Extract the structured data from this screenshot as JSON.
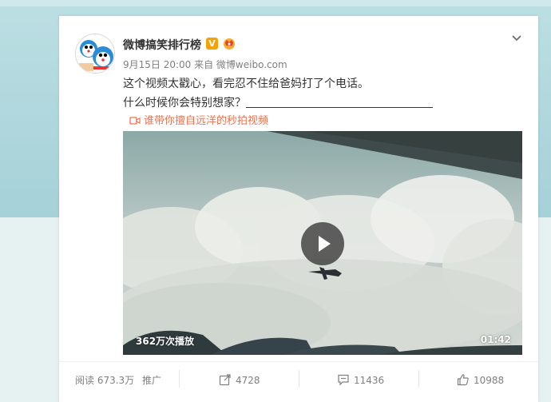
{
  "post": {
    "author": "微博搞笑排行榜",
    "verified_badge": "V",
    "meta": "9月15日 20:00 来自 微博weibo.com",
    "text_line1": "这个视频太戳心，看完忍不住给爸妈打了个电话。",
    "text_line2": "什么时候你会特别想家？",
    "video_link_label": "谁带你擅自远洋的秒拍视频"
  },
  "video": {
    "play_count": "362万次播放",
    "duration": "01:42"
  },
  "footer": {
    "read_count": "阅读 673.3万",
    "promote": "推广",
    "repost_count": "4728",
    "comment_count": "11436",
    "like_count": "10988"
  },
  "colors": {
    "accent_link": "#eb7350",
    "badge_orange": "#f7a200",
    "text_main": "#333333",
    "text_meta": "#808080"
  },
  "icons": [
    "chevron-down-icon",
    "video-camera-icon",
    "play-icon",
    "repost-icon",
    "comment-icon",
    "like-icon",
    "crown-icon"
  ]
}
